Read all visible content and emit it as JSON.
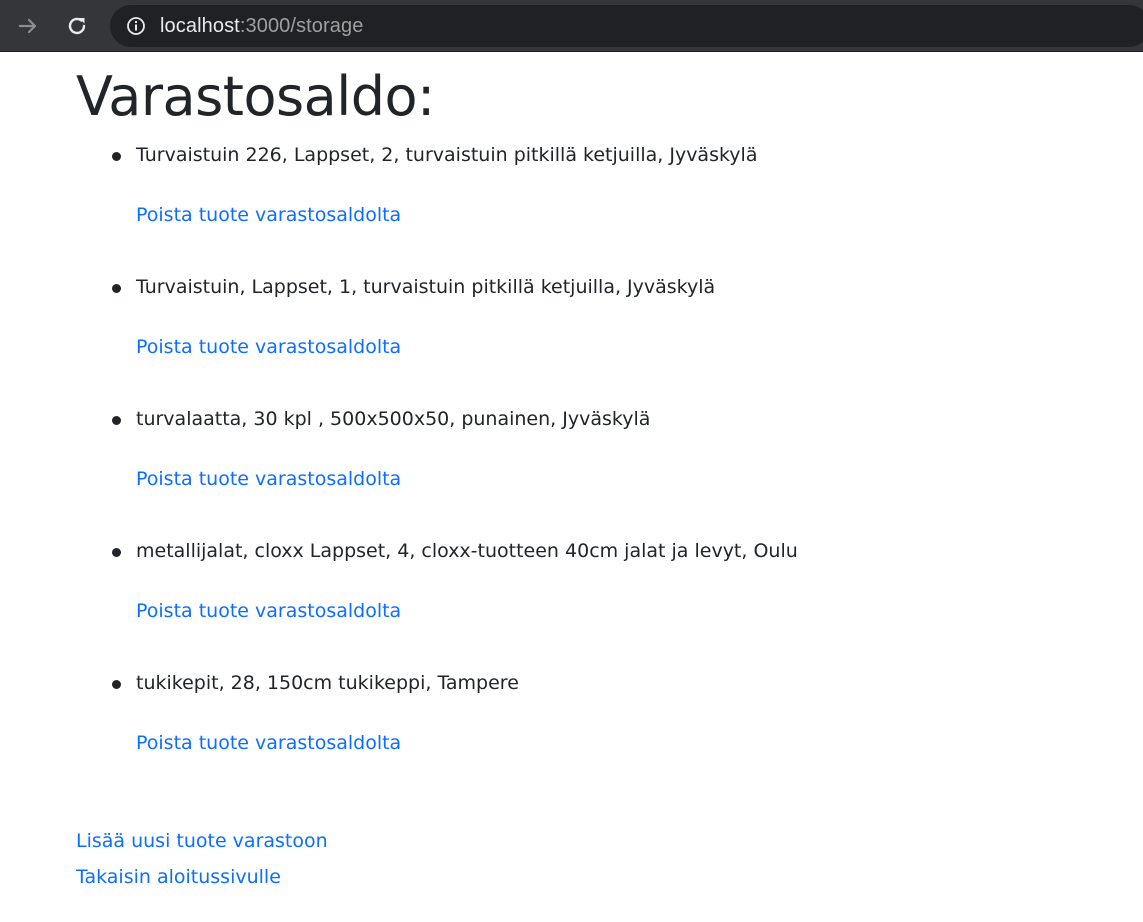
{
  "browser": {
    "url_host": "localhost",
    "url_rest": ":3000/storage"
  },
  "page": {
    "title": "Varastosaldo:",
    "items": [
      {
        "text": "Turvaistuin 226, Lappset, 2, turvaistuin pitkillä ketjuilla, Jyväskylä",
        "remove_label": "Poista tuote varastosaldolta"
      },
      {
        "text": "Turvaistuin, Lappset, 1, turvaistuin pitkillä ketjuilla, Jyväskylä",
        "remove_label": "Poista tuote varastosaldolta"
      },
      {
        "text": "turvalaatta, 30 kpl , 500x500x50, punainen, Jyväskylä",
        "remove_label": "Poista tuote varastosaldolta"
      },
      {
        "text": "metallijalat, cloxx Lappset, 4, cloxx-tuotteen 40cm jalat ja levyt, Oulu",
        "remove_label": "Poista tuote varastosaldolta"
      },
      {
        "text": "tukikepit, 28, 150cm tukikeppi, Tampere",
        "remove_label": "Poista tuote varastosaldolta"
      }
    ],
    "add_link": "Lisää uusi tuote varastoon",
    "back_link": "Takaisin aloitussivulle"
  },
  "colors": {
    "link": "#0d6efd",
    "text": "#212529",
    "toolbar": "#35363a",
    "omnibox": "#202124"
  },
  "icons": [
    "forward-arrow-icon",
    "reload-icon",
    "info-icon"
  ]
}
